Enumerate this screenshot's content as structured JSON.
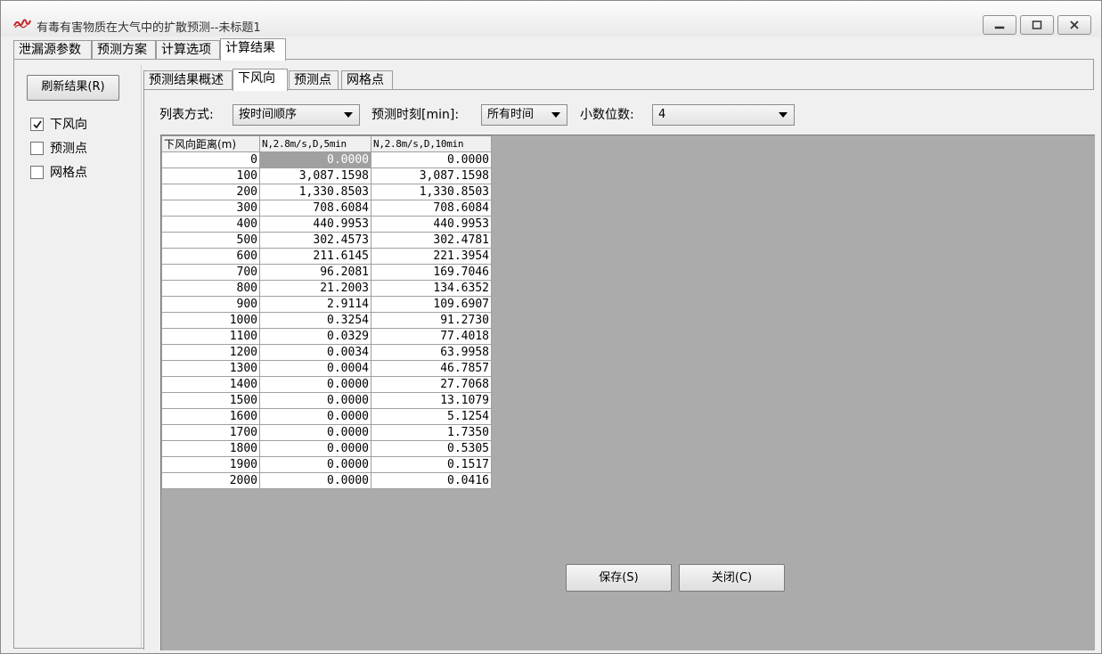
{
  "window": {
    "title": "有毒有害物质在大气中的扩散预测--未标题1",
    "controls": [
      "minimize-icon",
      "maximize-icon",
      "close-icon"
    ]
  },
  "main_tabs": [
    {
      "label": "泄漏源参数",
      "active": false
    },
    {
      "label": "预测方案",
      "active": false
    },
    {
      "label": "计算选项",
      "active": false
    },
    {
      "label": "计算结果",
      "active": true
    }
  ],
  "left_panel": {
    "refresh_button": "刷新结果(R)",
    "checkboxes": [
      {
        "label": "下风向",
        "checked": true
      },
      {
        "label": "预测点",
        "checked": false
      },
      {
        "label": "网格点",
        "checked": false
      }
    ]
  },
  "sub_tabs": [
    {
      "label": "预测结果概述",
      "active": false
    },
    {
      "label": "下风向",
      "active": true
    },
    {
      "label": "预测点",
      "active": false
    },
    {
      "label": "网格点",
      "active": false
    }
  ],
  "toolbar": {
    "list_mode_label": "列表方式:",
    "list_mode_value": "按时间顺序",
    "time_label": "预测时刻[min]:",
    "time_value": "所有时间",
    "decimals_label": "小数位数:",
    "decimals_value": "4"
  },
  "table": {
    "headers": [
      "下风向距离(m)",
      "N,2.8m/s,D,5min",
      "N,2.8m/s,D,10min"
    ],
    "rows": [
      [
        "0",
        "0.0000",
        "0.0000"
      ],
      [
        "100",
        "3,087.1598",
        "3,087.1598"
      ],
      [
        "200",
        "1,330.8503",
        "1,330.8503"
      ],
      [
        "300",
        "708.6084",
        "708.6084"
      ],
      [
        "400",
        "440.9953",
        "440.9953"
      ],
      [
        "500",
        "302.4573",
        "302.4781"
      ],
      [
        "600",
        "211.6145",
        "221.3954"
      ],
      [
        "700",
        "96.2081",
        "169.7046"
      ],
      [
        "800",
        "21.2003",
        "134.6352"
      ],
      [
        "900",
        "2.9114",
        "109.6907"
      ],
      [
        "1000",
        "0.3254",
        "91.2730"
      ],
      [
        "1100",
        "0.0329",
        "77.4018"
      ],
      [
        "1200",
        "0.0034",
        "63.9958"
      ],
      [
        "1300",
        "0.0004",
        "46.7857"
      ],
      [
        "1400",
        "0.0000",
        "27.7068"
      ],
      [
        "1500",
        "0.0000",
        "13.1079"
      ],
      [
        "1600",
        "0.0000",
        "5.1254"
      ],
      [
        "1700",
        "0.0000",
        "1.7350"
      ],
      [
        "1800",
        "0.0000",
        "0.5305"
      ],
      [
        "1900",
        "0.0000",
        "0.1517"
      ],
      [
        "2000",
        "0.0000",
        "0.0416"
      ]
    ]
  },
  "buttons": {
    "save": "保存(S)",
    "close": "关闭(C)"
  },
  "colors": {
    "window_bg": "#f0f0f0",
    "grid_bg": "#ababab",
    "selected_cell": "#a0a0a0",
    "icon_red": "#c0262a"
  }
}
